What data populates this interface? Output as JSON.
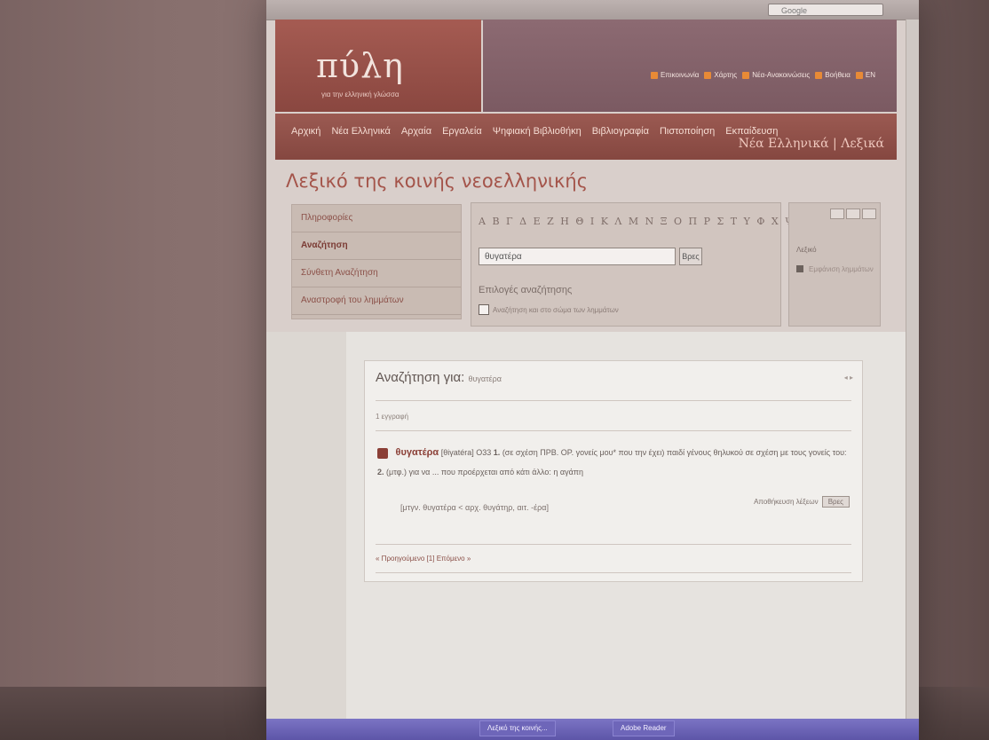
{
  "browser": {
    "search_placeholder": "Google"
  },
  "header": {
    "logo": "πύλη",
    "logo_subtitle": "για την ελληνική γλώσσα",
    "top_links": [
      "Επικοινωνία",
      "Χάρτης",
      "Νέα-Ανακοινώσεις",
      "Βοήθεια",
      "EN"
    ]
  },
  "menu": {
    "items": [
      "Αρχική",
      "Νέα Ελληνικά",
      "Αρχαία",
      "Εργαλεία",
      "Ψηφιακή Βιβλιοθήκη",
      "Βιβλιογραφία",
      "Πιστοποίηση",
      "Εκπαίδευση"
    ],
    "brand": "Νέα Ελληνικά | Λεξικά"
  },
  "page": {
    "title": "Λεξικό της κοινής νεοελληνικής"
  },
  "sidebar": {
    "items": [
      "Πληροφορίες",
      "Αναζήτηση",
      "Σύνθετη Αναζήτηση",
      "Αναστροφή του λημμάτων"
    ]
  },
  "search": {
    "alphabet": "Α Β Γ Δ Ε Ζ Η Θ Ι Κ Λ Μ Ν Ξ Ο Π Ρ Σ Τ Υ Φ Χ Ψ Ω",
    "value": "θυγατέρα",
    "go_label": "Βρες",
    "options_title": "Επιλογές αναζήτησης",
    "option_label": "Αναζήτηση και στο σώμα των λημμάτων"
  },
  "right_panel": {
    "title": "Λεξικό",
    "option": "Εμφάνιση λημμάτων"
  },
  "results": {
    "title": "Αναζήτηση για:",
    "term": "θυγατέρα",
    "hits": "1 εγγραφή",
    "entry_head": "θυγατέρα",
    "entry_pron": "[θiγatéra]",
    "entry_pos": "Ο33",
    "entry_sense1_num": "1.",
    "entry_sense1": "(σε σχέση ΠΡΒ. ΟΡ. γονείς μου* που την έχει) παιδί γένους θηλυκού σε σχέση με τους γονείς του:",
    "entry_sense2_num": "2.",
    "entry_sense2": "(μτφ.) για να ... που προέρχεται από κάτι άλλο: η αγάπη",
    "derivation": "[μτγν. θυγατέρα < αρχ. θυγάτηρ, αιτ. -έρα]",
    "export_label": "Αποθήκευση λέξεων",
    "export_btn": "Βρες",
    "nav": "« Προηγούμενο  [1]  Επόμενο »"
  },
  "taskbar": {
    "items": [
      "Λεξικό της κοινής...",
      "Adobe Reader"
    ]
  }
}
